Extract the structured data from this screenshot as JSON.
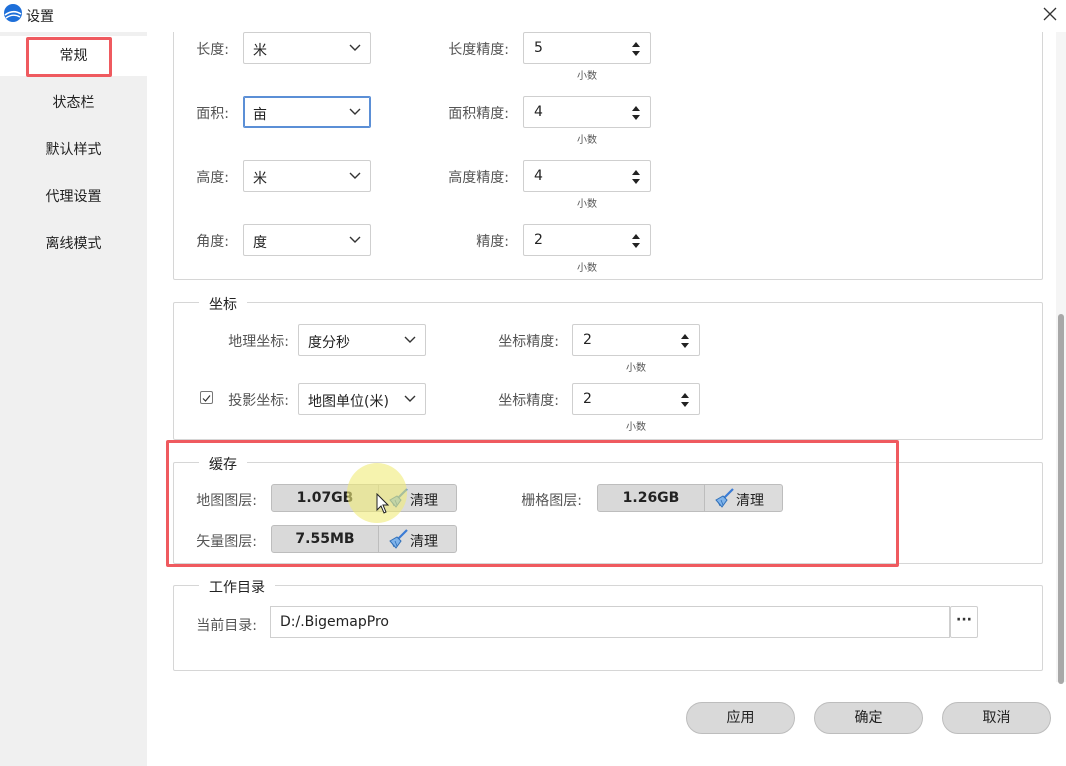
{
  "window": {
    "title": "设置",
    "colors": {
      "highlight_box": "#ef5a5f",
      "sidebar_bg": "#f0f0f0",
      "focus_border": "#5b8fd6",
      "cursor_halo": "#f0eb78"
    }
  },
  "sidebar": {
    "items": [
      {
        "label": "常规",
        "active": true
      },
      {
        "label": "状态栏"
      },
      {
        "label": "默认样式"
      },
      {
        "label": "代理设置"
      },
      {
        "label": "离线模式"
      }
    ]
  },
  "units": {
    "rows": [
      {
        "label": "长度:",
        "unit": "米",
        "precision_label": "长度精度:",
        "precision": "5",
        "note": "小数"
      },
      {
        "label": "面积:",
        "unit": "亩",
        "precision_label": "面积精度:",
        "precision": "4",
        "note": "小数"
      },
      {
        "label": "高度:",
        "unit": "米",
        "precision_label": "高度精度:",
        "precision": "4",
        "note": "小数"
      },
      {
        "label": "角度:",
        "unit": "度",
        "precision_label": "精度:",
        "precision": "2",
        "note": "小数"
      }
    ]
  },
  "coords": {
    "title": "坐标",
    "geo_label": "地理坐标:",
    "geo_value": "度分秒",
    "geo_precision_label": "坐标精度:",
    "geo_precision": "2",
    "geo_note": "小数",
    "proj_label": "投影坐标:",
    "proj_value": "地图单位(米)",
    "proj_checked": true,
    "proj_precision_label": "坐标精度:",
    "proj_precision": "2",
    "proj_note": "小数"
  },
  "cache": {
    "title": "缓存",
    "map_label": "地图图层:",
    "map_size": "1.07GB",
    "raster_label": "栅格图层:",
    "raster_size": "1.26GB",
    "vector_label": "矢量图层:",
    "vector_size": "7.55MB",
    "clean_label": "清理"
  },
  "workdir": {
    "title": "工作目录",
    "label": "当前目录:",
    "path": "D:/.BigemapPro",
    "browse_label": "···"
  },
  "footer": {
    "apply": "应用",
    "ok": "确定",
    "cancel": "取消"
  }
}
